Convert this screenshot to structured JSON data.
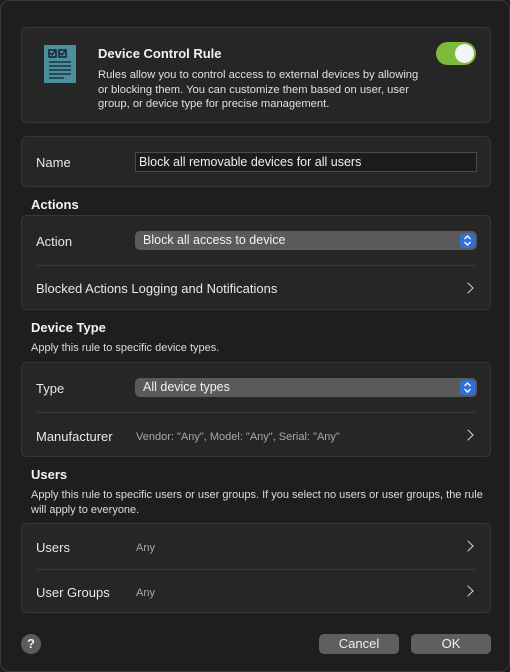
{
  "header": {
    "title": "Device Control Rule",
    "description": "Rules allow you to control access to external devices by allowing or blocking them. You can customize them based on user, user group, or device type for precise management.",
    "enabled": true,
    "icon": "document-list-icon"
  },
  "name_row": {
    "label": "Name",
    "value": "Block all removable devices for all users"
  },
  "actions": {
    "title": "Actions",
    "action_label": "Action",
    "action_value": "Block all access to device",
    "logging_label": "Blocked Actions Logging and Notifications"
  },
  "device_type": {
    "title": "Device Type",
    "description": "Apply this rule to specific device types.",
    "type_label": "Type",
    "type_value": "All device types",
    "manufacturer_label": "Manufacturer",
    "manufacturer_value": "Vendor: \"Any\", Model: \"Any\", Serial: \"Any\""
  },
  "users": {
    "title": "Users",
    "description": "Apply this rule to specific users or user groups. If you select no users or user groups, the rule will apply to everyone.",
    "users_label": "Users",
    "users_value": "Any",
    "groups_label": "User Groups",
    "groups_value": "Any"
  },
  "footer": {
    "help": "?",
    "cancel": "Cancel",
    "ok": "OK"
  },
  "colors": {
    "toggle_on": "#7dbb3c",
    "accent": "#2f6fd6",
    "icon": "#4a8f9a"
  }
}
